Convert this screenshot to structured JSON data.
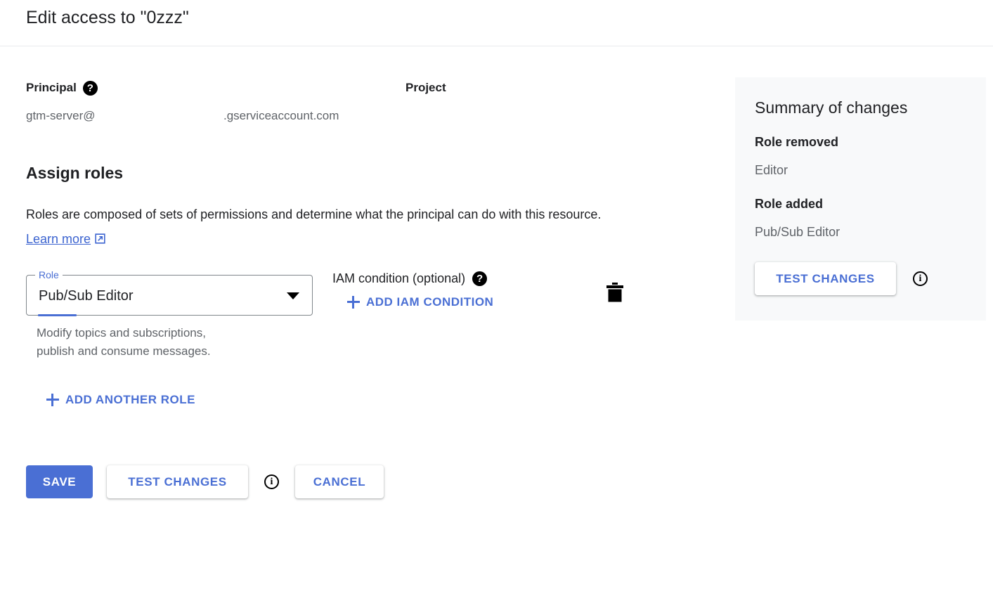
{
  "header": {
    "title": "Edit access to \"0zzz\""
  },
  "principal": {
    "label": "Principal",
    "help_icon": "help-icon",
    "value_prefix": "gtm-server@",
    "value_suffix": ".gserviceaccount.com"
  },
  "project": {
    "label": "Project",
    "value": ""
  },
  "assign_roles": {
    "title": "Assign roles",
    "description": "Roles are composed of sets of permissions and determine what the principal can do with this resource. ",
    "learn_more_label": "Learn more",
    "learn_more_icon": "open-in-new-icon",
    "role_field": {
      "legend": "Role",
      "value": "Pub/Sub Editor",
      "caret_icon": "chevron-down-icon",
      "help_text": "Modify topics and subscriptions,\npublish and consume messages."
    },
    "iam_condition": {
      "label": "IAM condition (optional)",
      "help_icon": "help-icon",
      "add_label": "ADD IAM CONDITION",
      "add_icon": "plus-icon"
    },
    "delete_icon": "trash-icon",
    "add_another_role_label": "ADD ANOTHER ROLE",
    "add_another_role_icon": "plus-icon"
  },
  "actions": {
    "save_label": "SAVE",
    "test_changes_label": "TEST CHANGES",
    "info_icon": "info-icon",
    "cancel_label": "CANCEL"
  },
  "summary": {
    "title": "Summary of changes",
    "role_removed_heading": "Role removed",
    "role_removed_value": "Editor",
    "role_added_heading": "Role added",
    "role_added_value": "Pub/Sub Editor",
    "test_changes_label": "TEST CHANGES",
    "info_icon": "info-icon"
  },
  "colors": {
    "accent_blue": "#4a6fd4",
    "link_blue": "#3c64d0",
    "panel_bg": "#f8f9fa",
    "text_primary": "#202124",
    "text_secondary": "#5f6368",
    "border": "#80868b"
  }
}
